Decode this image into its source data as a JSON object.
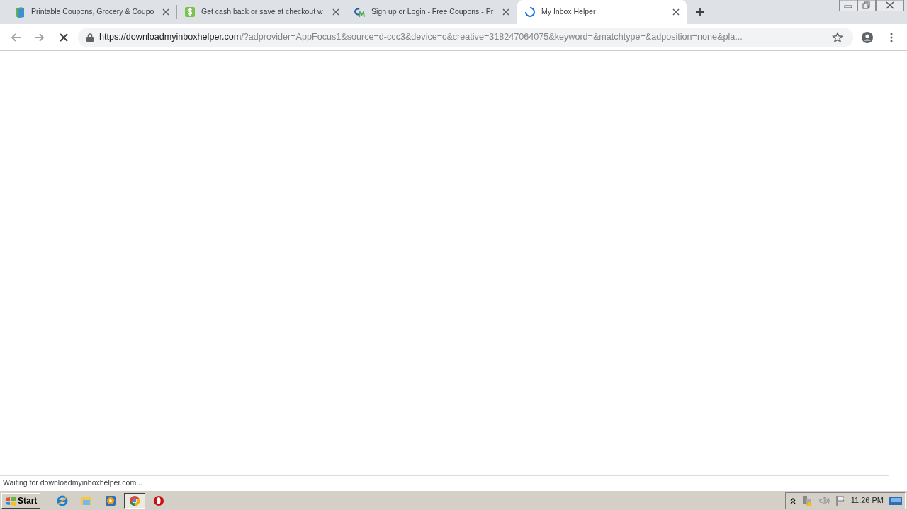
{
  "tabs": [
    {
      "title": "Printable Coupons, Grocery & Coupo",
      "kind": "book",
      "selected": false,
      "loading": false
    },
    {
      "title": "Get cash back or save at checkout w",
      "kind": "dollar",
      "selected": false,
      "loading": false
    },
    {
      "title": "Sign up or Login - Free Coupons - Pr",
      "kind": "cm",
      "selected": false,
      "loading": false
    },
    {
      "title": "My Inbox Helper",
      "selected": true,
      "loading": true
    }
  ],
  "address_bar": {
    "host": "https://downloadmyinboxhelper.com",
    "rest": "/?adprovider=AppFocus1&source=d-ccc3&device=c&creative=318247064075&keyword=&matchtype=&adposition=none&pla..."
  },
  "loading": true,
  "status_bar": {
    "text": "Waiting for downloadmyinboxhelper.com..."
  },
  "taskbar": {
    "start": "Start",
    "apps": [
      {
        "kind": "ie",
        "selected": false
      },
      {
        "kind": "explorer",
        "selected": false
      },
      {
        "kind": "media",
        "selected": false
      },
      {
        "kind": "chrome",
        "selected": true
      },
      {
        "kind": "opera",
        "selected": false
      }
    ],
    "clock": "11:26 PM"
  }
}
